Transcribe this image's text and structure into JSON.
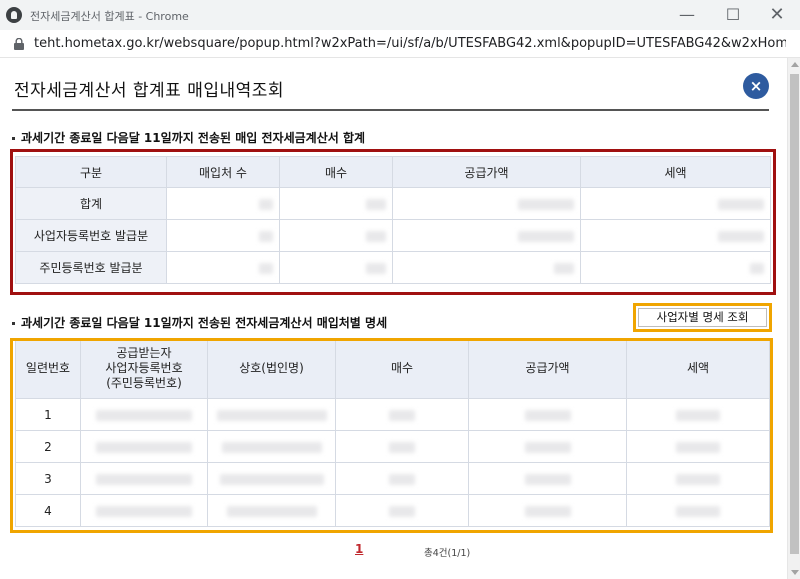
{
  "window": {
    "title": "전자세금계산서 합계표 - Chrome",
    "url": "teht.hometax.go.kr/websquare/popup.html?w2xPath=/ui/sf/a/b/UTESFABG42.xml&popupID=UTESFABG42&w2xHome..."
  },
  "popup": {
    "title": "전자세금계산서 합계표 매입내역조회",
    "close_label": "×"
  },
  "summary": {
    "section_title": "과세기간 종료일 다음달 11일까지 전송된 매입 전자세금계산서 합계",
    "columns": [
      "구분",
      "매입처 수",
      "매수",
      "공급가액",
      "세액"
    ],
    "rows": [
      {
        "label": "합계",
        "values": [
          "",
          "",
          "",
          ""
        ]
      },
      {
        "label": "사업자등록번호 발급분",
        "values": [
          "",
          "",
          "",
          ""
        ]
      },
      {
        "label": "주민등록번호 발급분",
        "values": [
          "",
          "",
          "",
          ""
        ]
      }
    ]
  },
  "detail": {
    "section_title": "과세기간 종료일 다음달 11일까지 전송된 전자세금계산서 매입처별 명세",
    "lookup_button": "사업자별 명세 조회",
    "columns": [
      "일련번호",
      "공급받는자\n사업자등록번호\n(주민등록번호)",
      "상호(법인명)",
      "매수",
      "공급가액",
      "세액"
    ],
    "rows": [
      {
        "no": "1"
      },
      {
        "no": "2"
      },
      {
        "no": "3"
      },
      {
        "no": "4"
      }
    ]
  },
  "pager": {
    "current_page": "1",
    "total_text": "총4건(1/1)"
  },
  "colors": {
    "highlight_red": "#a01010",
    "highlight_orange": "#f0a500",
    "close_button": "#2e5b9f",
    "header_bg": "#eaeef6"
  }
}
